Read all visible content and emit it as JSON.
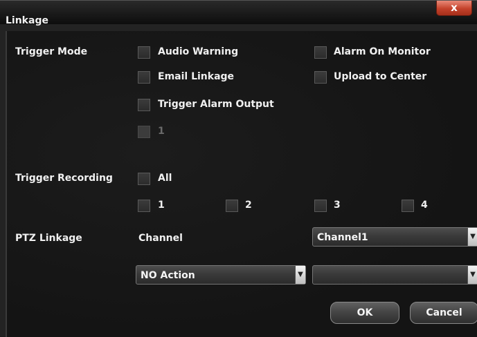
{
  "window": {
    "title": "Linkage",
    "close_label": "x"
  },
  "trigger_mode": {
    "label": "Trigger Mode",
    "options": {
      "audio_warning": "Audio Warning",
      "alarm_on_monitor": "Alarm On Monitor",
      "email_linkage": "Email Linkage",
      "upload_to_center": "Upload to Center",
      "trigger_alarm_output": "Trigger Alarm Output",
      "output_1": "1"
    }
  },
  "trigger_recording": {
    "label": "Trigger Recording",
    "all": "All",
    "channels": [
      "1",
      "2",
      "3",
      "4"
    ]
  },
  "ptz_linkage": {
    "label": "PTZ Linkage",
    "channel_label": "Channel",
    "channel_value": "Channel1",
    "action_value": "NO Action",
    "preset_value": ""
  },
  "buttons": {
    "ok": "OK",
    "cancel": "Cancel"
  },
  "colors": {
    "background": "#141414",
    "close_button": "#c4422b",
    "text": "#f0f0f0"
  }
}
